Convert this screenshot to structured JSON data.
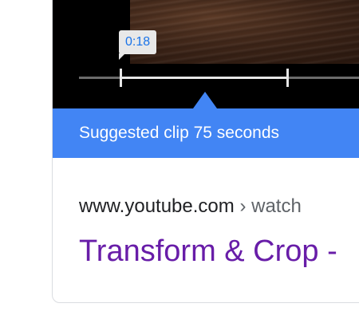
{
  "video": {
    "time_tooltip": "0:18"
  },
  "banner": {
    "text": "Suggested clip 75 seconds"
  },
  "result": {
    "domain": "www.youtube.com",
    "separator": "›",
    "path": "watch",
    "title": "Transform & Crop -"
  },
  "colors": {
    "banner": "#4285f4",
    "title_link": "#681da8",
    "tooltip_text": "#1a73e8"
  }
}
